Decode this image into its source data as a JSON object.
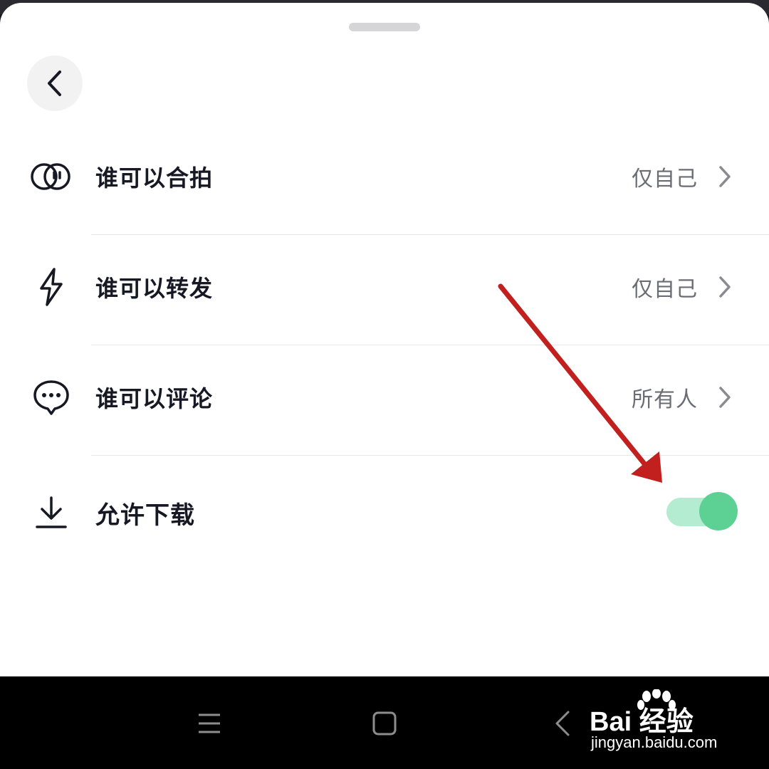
{
  "sheet": {
    "back_icon": "chevron-left-icon"
  },
  "settings": [
    {
      "icon": "duet-icon",
      "label": "谁可以合拍",
      "value": "仅自己"
    },
    {
      "icon": "lightning-icon",
      "label": "谁可以转发",
      "value": "仅自己"
    },
    {
      "icon": "comment-icon",
      "label": "谁可以评论",
      "value": "所有人"
    }
  ],
  "download": {
    "icon": "download-icon",
    "label": "允许下载",
    "enabled": true
  },
  "navbar": {
    "menu_icon": "menu-icon",
    "home_icon": "square-home-icon",
    "back_icon": "back-triangle-icon"
  },
  "watermark": {
    "logo": "Bai 经验",
    "url": "jingyan.baidu.com"
  },
  "colors": {
    "toggle_track": "#b3ecd1",
    "toggle_knob": "#5cd193",
    "arrow": "#c21f1f",
    "text_primary": "#161823",
    "text_secondary": "#6b6d74"
  }
}
